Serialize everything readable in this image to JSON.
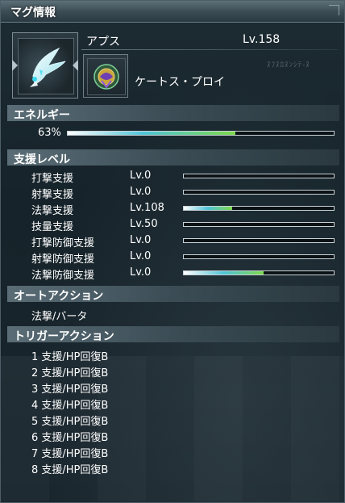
{
  "window": {
    "title": "マグ情報"
  },
  "mag": {
    "name": "アプス",
    "level": "Lv.158",
    "device_name": "ケートス・プロイ"
  },
  "background_watermark": "ﾇﾌﾇﾛﾇﾝｼﾃ-ﾇ",
  "energy": {
    "header": "エネルギー",
    "percent_text": "63%",
    "percent": 63,
    "bar_colors": {
      "start": "#ffffff",
      "mid": "#4ec4d8",
      "end": "#7ed84a"
    }
  },
  "support": {
    "header": "支援レベル",
    "rows": [
      {
        "label": "打撃支援",
        "level": "Lv.0",
        "progress": 0
      },
      {
        "label": "射撃支援",
        "level": "Lv.0",
        "progress": 0
      },
      {
        "label": "法撃支援",
        "level": "Lv.108",
        "progress": 0.32
      },
      {
        "label": "技量支援",
        "level": "Lv.50",
        "progress": 0
      },
      {
        "label": "打撃防御支援",
        "level": "Lv.0",
        "progress": 0
      },
      {
        "label": "射撃防御支援",
        "level": "Lv.0",
        "progress": 0
      },
      {
        "label": "法撃防御支援",
        "level": "Lv.0",
        "progress": 0.53
      }
    ]
  },
  "auto_action": {
    "header": "オートアクション",
    "value": "法撃/バータ"
  },
  "trigger_action": {
    "header": "トリガーアクション",
    "items": [
      "1 支援/HP回復B",
      "2 支援/HP回復B",
      "3 支援/HP回復B",
      "4 支援/HP回復B",
      "5 支援/HP回復B",
      "6 支援/HP回復B",
      "7 支援/HP回復B",
      "8 支援/HP回復B"
    ]
  }
}
